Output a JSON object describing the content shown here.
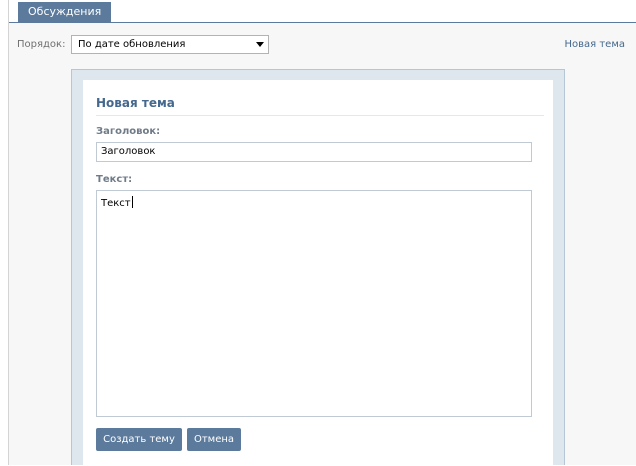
{
  "tabs": [
    {
      "label": "Обсуждения",
      "active": true
    }
  ],
  "sort": {
    "label": "Порядок:",
    "selected": "По дате обновления"
  },
  "header_link": "Новая тема",
  "dialog": {
    "title": "Новая тема",
    "title_field_label": "Заголовок:",
    "title_field_value": "Заголовок",
    "text_field_label": "Текст:",
    "text_field_value": "Текст",
    "create_button": "Создать тему",
    "cancel_button": "Отмена"
  },
  "colors": {
    "accent": "#5b7a9c",
    "link": "#45688e",
    "dialog_frame": "#dee6ee"
  },
  "icons": {
    "select_arrow": "chevron-down-icon"
  }
}
